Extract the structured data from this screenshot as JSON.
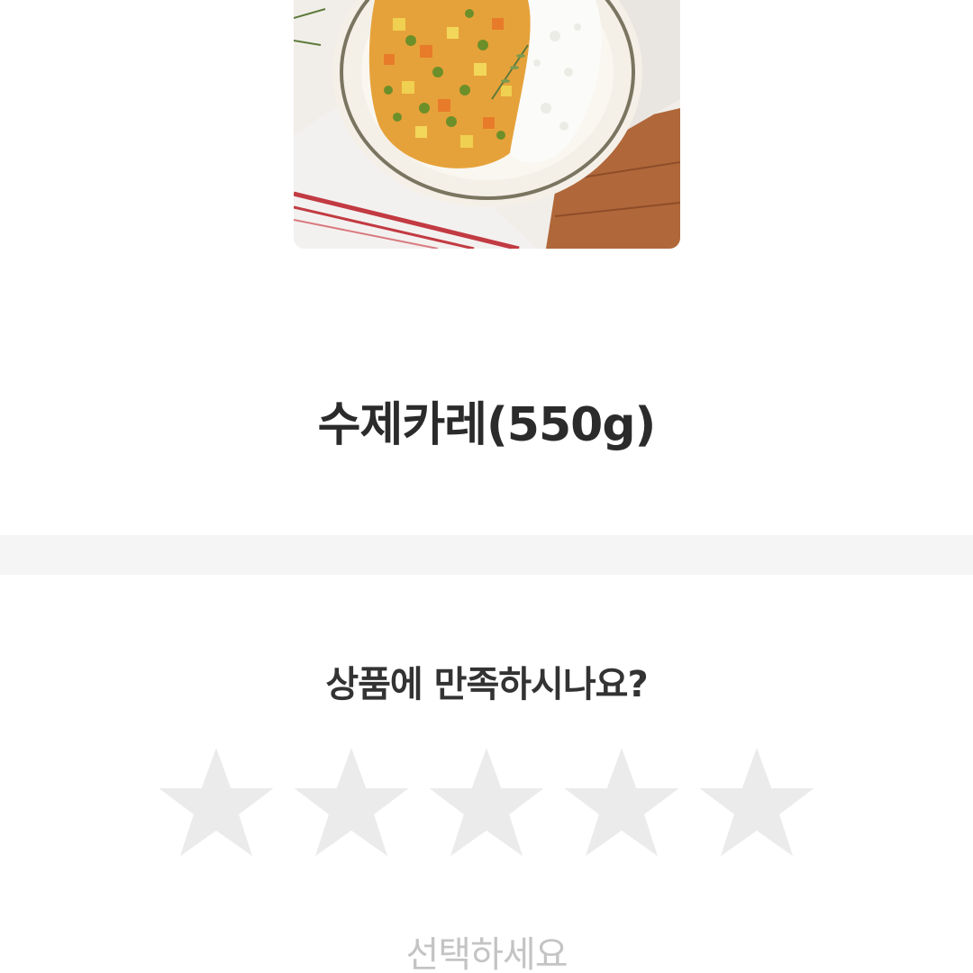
{
  "product": {
    "name": "수제카레(550g)",
    "image_alt": "curry with rice"
  },
  "rating": {
    "question": "상품에 만족하시나요?",
    "max_stars": 5,
    "selected_stars": 0,
    "star_color_empty": "#ebebeb",
    "hint": "선택하세요"
  },
  "colors": {
    "divider": "#f5f5f5",
    "text_primary": "#2b2b2b",
    "text_muted": "#c4c4c4"
  }
}
